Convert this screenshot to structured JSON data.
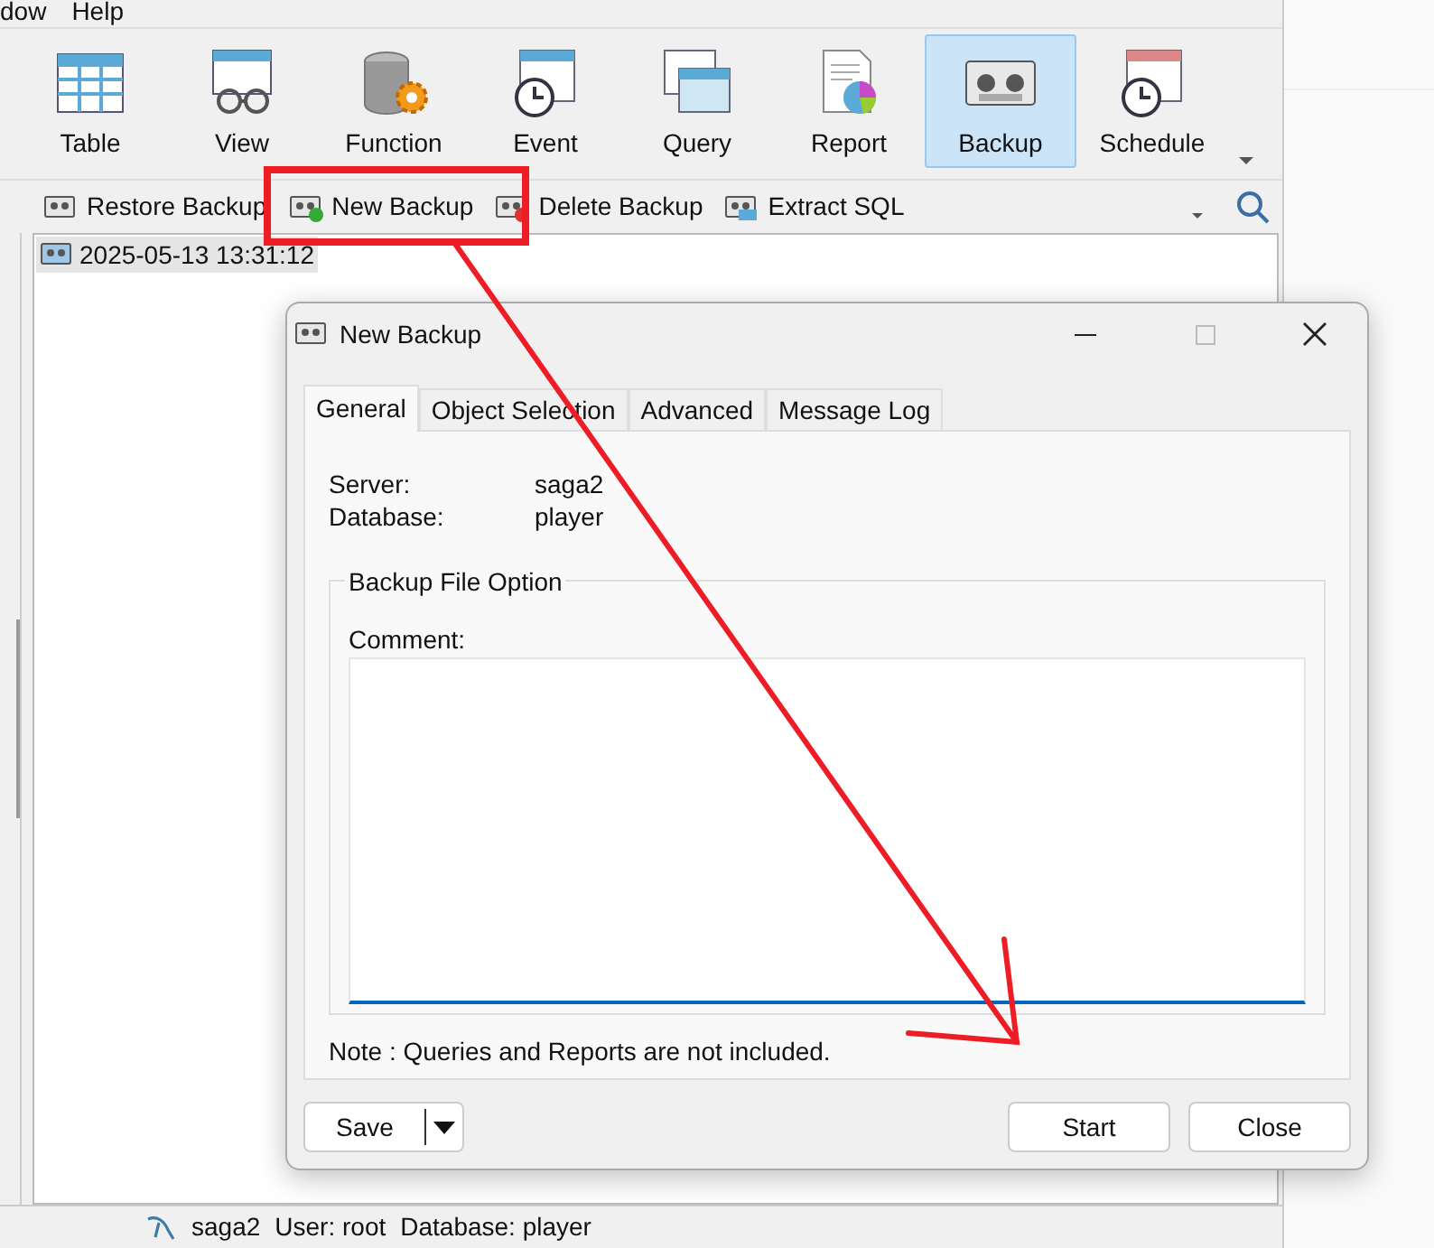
{
  "menu": [
    {
      "label": "dow"
    },
    {
      "label": "Help"
    }
  ],
  "toolbar": [
    {
      "label": "Table",
      "kind": "table",
      "selected": false
    },
    {
      "label": "View",
      "kind": "view",
      "selected": false
    },
    {
      "label": "Function",
      "kind": "function",
      "selected": false
    },
    {
      "label": "Event",
      "kind": "event",
      "selected": false
    },
    {
      "label": "Query",
      "kind": "query",
      "selected": false
    },
    {
      "label": "Report",
      "kind": "report",
      "selected": false
    },
    {
      "label": "Backup",
      "kind": "backup",
      "selected": true
    },
    {
      "label": "Schedule",
      "kind": "schedule",
      "selected": false
    }
  ],
  "actions": [
    {
      "label": "Restore Backup",
      "kind": "restore"
    },
    {
      "label": "New Backup",
      "kind": "new"
    },
    {
      "label": "Delete Backup",
      "kind": "delete"
    },
    {
      "label": "Extract SQL",
      "kind": "extract"
    }
  ],
  "backups": [
    {
      "label": "2025-05-13 13:31:12",
      "selected": true
    }
  ],
  "dialog": {
    "title": "New Backup",
    "tabs": [
      {
        "label": "General",
        "selected": true
      },
      {
        "label": "Object Selection",
        "selected": false
      },
      {
        "label": "Advanced",
        "selected": false
      },
      {
        "label": "Message Log",
        "selected": false
      }
    ],
    "fields": [
      {
        "label": "Server:",
        "value": "saga2"
      },
      {
        "label": "Database:",
        "value": "player"
      }
    ],
    "group": "Backup File Option",
    "comment_label": "Comment:",
    "note": "Note : Queries and Reports are not included.",
    "save": "Save",
    "start": "Start",
    "close": "Close"
  },
  "status": {
    "server": "saga2",
    "user": "User: root",
    "database": "Database: player"
  }
}
